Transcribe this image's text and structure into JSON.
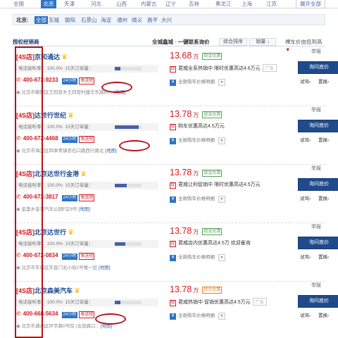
{
  "cities": [
    "全国",
    "北京",
    "天津",
    "河北",
    "山西",
    "内蒙古",
    "辽宁",
    "吉林",
    "黑龙江",
    "上海",
    "江苏"
  ],
  "cities_active": 1,
  "expand": "展开全部",
  "district_label": "北京:",
  "districts": [
    "全部",
    "东城",
    "朝阳",
    "石景山",
    "海淀",
    "通州",
    "顺义",
    "昌平",
    "大兴"
  ],
  "districts_active": 0,
  "sortbar": {
    "left": "授权经销商",
    "scope": "全城鑫城",
    "compare": "一键联系询价",
    "sort": "综合排序",
    "sales": "销量",
    "arrow": "↓",
    "price_sort": "裸车价由低到高",
    "down_arrow": "▼"
  },
  "common": {
    "tag": "[4S店]",
    "crown": "♛",
    "phone_label": "电话接听率",
    "rate": "100.0%",
    "sold_label": "15天订单量",
    "hours": "24小时",
    "send": "发送短",
    "map": "[地图]",
    "wan": "万",
    "calc": "全款购车价格明细",
    "calc_arrow": "▾",
    "inquiry": "询问底价",
    "trial": "试驾›",
    "swap": "置换›",
    "report": "举报",
    "ad": "广告"
  },
  "dealers": [
    {
      "name": "京和通达",
      "price": "13.68",
      "promo": "现金优惠",
      "promo_style": "green",
      "offer": "君威全系热销中 限时优惠高达4.6万元",
      "show_ad": true,
      "phone": "400-672-9233",
      "address": "北京市朝阳区王四营乡王四营村盛华东路80...",
      "sold": 0.2
    },
    {
      "name": "达世行世纪",
      "price": "13.78",
      "promo": "现金优惠",
      "promo_style": "green",
      "offer": "购车优惠高达4.5万元",
      "show_ad": false,
      "phone": "400-672-4468",
      "address": "北京市海淀区四季青镇杏石口路西行路北",
      "sold": 0.9
    },
    {
      "name": "北京达世行金港",
      "price": "13.78",
      "promo": "现金优惠",
      "promo_style": "green",
      "offer": "君威让利促销中 限时优惠高达4.5万元",
      "show_ad": false,
      "phone": "400-672-3817",
      "address": "金盏乡金港汽车公园F区8号",
      "sold": 0.45
    },
    {
      "name": "北京达世行",
      "price": "13.78",
      "promo": "现金优惠",
      "promo_style": "green",
      "offer": "君威店内优惠高达4.5万 欢迎垂询",
      "show_ad": false,
      "phone": "400-672-0834",
      "address": "北京市东城区东直门北小街2号楼一层",
      "sold": 0.4
    },
    {
      "name": "北京森美汽车",
      "price": "13.78",
      "promo": "综合优惠",
      "promo_style": "orange",
      "offer": "君威热销中 促销优惠高达4.5万元",
      "show_ad": true,
      "phone": "400-668-5634",
      "address": "北京市通州区环宇路5号院 (北苑路口...",
      "sold": 0.2
    }
  ]
}
